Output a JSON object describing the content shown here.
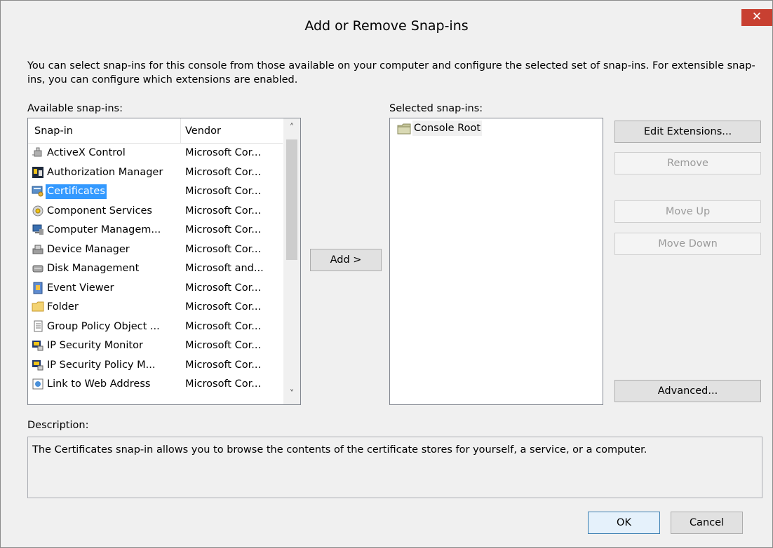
{
  "window": {
    "title": "Add or Remove Snap-ins",
    "close_glyph": "✕"
  },
  "intro_text": "You can select snap-ins for this console from those available on your computer and configure the selected set of snap-ins. For extensible snap-ins, you can configure which extensions are enabled.",
  "available": {
    "label": "Available snap-ins:",
    "columns": [
      "Snap-in",
      "Vendor"
    ],
    "rows": [
      {
        "name": "ActiveX Control",
        "vendor": "Microsoft Cor...",
        "icon": "activex-control-icon"
      },
      {
        "name": "Authorization Manager",
        "vendor": "Microsoft Cor...",
        "icon": "authorization-manager-icon"
      },
      {
        "name": "Certificates",
        "vendor": "Microsoft Cor...",
        "icon": "certificates-icon",
        "selected": true
      },
      {
        "name": "Component Services",
        "vendor": "Microsoft Cor...",
        "icon": "component-services-icon"
      },
      {
        "name": "Computer Managem...",
        "vendor": "Microsoft Cor...",
        "icon": "computer-management-icon"
      },
      {
        "name": "Device Manager",
        "vendor": "Microsoft Cor...",
        "icon": "device-manager-icon"
      },
      {
        "name": "Disk Management",
        "vendor": "Microsoft and...",
        "icon": "disk-management-icon"
      },
      {
        "name": "Event Viewer",
        "vendor": "Microsoft Cor...",
        "icon": "event-viewer-icon"
      },
      {
        "name": "Folder",
        "vendor": "Microsoft Cor...",
        "icon": "folder-icon"
      },
      {
        "name": "Group Policy Object ...",
        "vendor": "Microsoft Cor...",
        "icon": "group-policy-icon"
      },
      {
        "name": "IP Security Monitor",
        "vendor": "Microsoft Cor...",
        "icon": "ip-security-monitor-icon"
      },
      {
        "name": "IP Security Policy M...",
        "vendor": "Microsoft Cor...",
        "icon": "ip-security-policy-icon"
      },
      {
        "name": "Link to Web Address",
        "vendor": "Microsoft Cor...",
        "icon": "web-link-icon"
      }
    ],
    "scroll_up_glyph": "˄",
    "scroll_down_glyph": "˅"
  },
  "add_button": "Add >",
  "selected": {
    "label": "Selected snap-ins:",
    "items": [
      {
        "name": "Console Root",
        "icon": "folder-icon"
      }
    ]
  },
  "side_buttons": {
    "edit_extensions": "Edit Extensions...",
    "remove": "Remove",
    "move_up": "Move Up",
    "move_down": "Move Down",
    "advanced": "Advanced..."
  },
  "description": {
    "label": "Description:",
    "text": "The Certificates snap-in allows you to browse the contents of the certificate stores for yourself, a service, or a computer."
  },
  "footer": {
    "ok": "OK",
    "cancel": "Cancel"
  },
  "colors": {
    "selection": "#3399ff",
    "close_button": "#c84031",
    "dialog_background": "#f0f0f0"
  }
}
